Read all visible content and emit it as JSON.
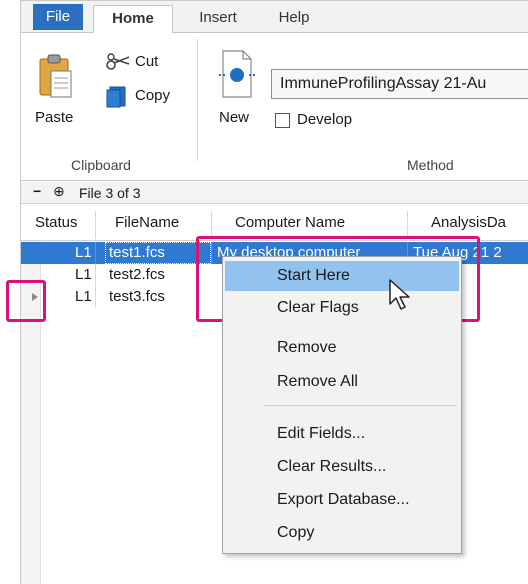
{
  "tabs": {
    "file": "File",
    "home": "Home",
    "insert": "Insert",
    "help": "Help"
  },
  "ribbon": {
    "paste": "Paste",
    "cut": "Cut",
    "copy": "Copy",
    "new": "New",
    "clipboard_group": "Clipboard",
    "method_group": "Method",
    "method_value": "ImmuneProfilingAssay 21-Au",
    "develop": "Develop",
    "develop_checked": false
  },
  "filebar": {
    "minus": "−",
    "pin": "⊕",
    "count": "File 3 of 3"
  },
  "grid": {
    "columns": [
      "Status",
      "FileName",
      "Computer Name",
      "AnalysisDa"
    ],
    "rows": [
      {
        "status": "L1",
        "file": "test1.fcs",
        "computer": "My desktop computer",
        "analysis": "Tue Aug 21 2",
        "selected": true
      },
      {
        "status": "L1",
        "file": "test2.fcs",
        "computer": "",
        "analysis": ""
      },
      {
        "status": "L1",
        "file": "test3.fcs",
        "computer": "",
        "analysis": ""
      }
    ]
  },
  "context_menu": {
    "items": [
      "Start Here",
      "Clear Flags",
      "Remove",
      "Remove All",
      "Edit Fields...",
      "Clear Results...",
      "Export Database...",
      "Copy"
    ],
    "highlighted": "Start Here"
  },
  "colors": {
    "accent": "#2b6fbf",
    "selection": "#2f7ad0",
    "menu_hover": "#92c3ee",
    "annotation": "#d9137a"
  }
}
